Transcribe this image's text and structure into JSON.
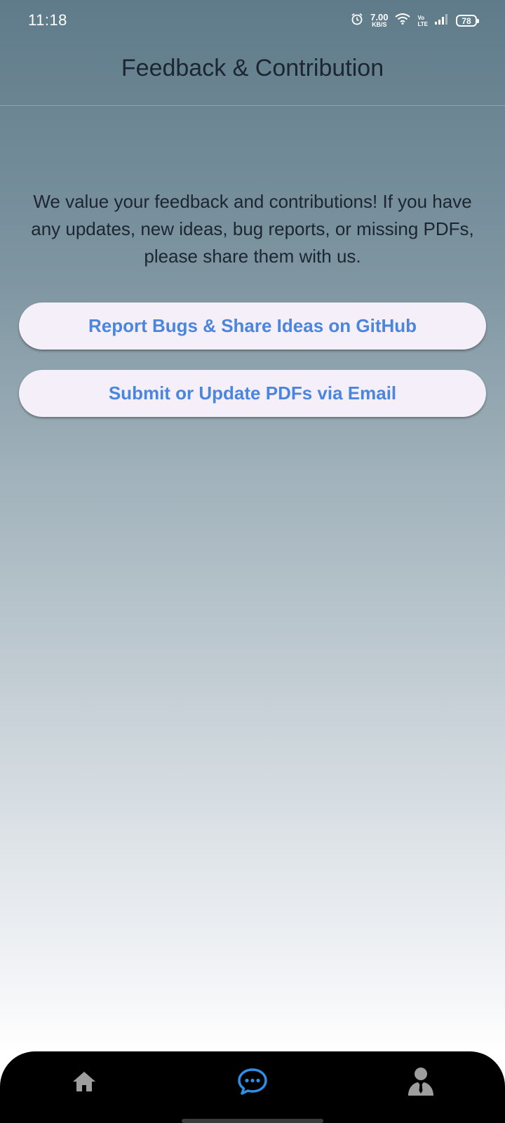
{
  "status_bar": {
    "time": "11:18",
    "net_speed_value": "7.00",
    "net_speed_unit": "KB/S",
    "volte_top": "Vo",
    "volte_bottom": "LTE",
    "battery": "78",
    "icons": [
      "alarm-icon",
      "wifi-icon",
      "volte-icon",
      "signal-icon",
      "battery-icon"
    ]
  },
  "app_bar": {
    "title": "Feedback & Contribution"
  },
  "main": {
    "intro_text": "We value your feedback and contributions! If you have any updates, new ideas, bug reports, or missing PDFs, please share them with us.",
    "buttons": [
      {
        "label": "Report Bugs & Share Ideas on GitHub"
      },
      {
        "label": "Submit or Update PDFs via Email"
      }
    ]
  },
  "bottom_nav": {
    "items": [
      {
        "icon": "home-icon",
        "active": false
      },
      {
        "icon": "chat-bubble-icon",
        "active": true
      },
      {
        "icon": "person-icon",
        "active": false
      }
    ],
    "active_color": "#2f8fe6",
    "inactive_color": "#9e9e9e"
  },
  "colors": {
    "button_text": "#4a86dd",
    "button_bg": "#f4eff8",
    "gradient_top": "#5f7b89",
    "gradient_bottom": "#ffffff"
  }
}
